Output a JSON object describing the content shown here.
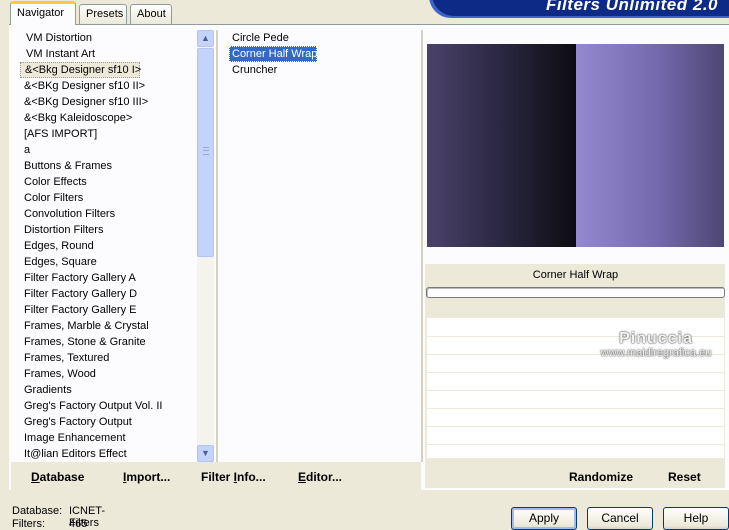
{
  "tabs": [
    {
      "label": "Navigator",
      "active": true
    },
    {
      "label": "Presets",
      "active": false
    },
    {
      "label": "About",
      "active": false
    }
  ],
  "banner_title": "Filters Unlimited 2.0",
  "categories": [
    "VM Distortion",
    "VM Instant Art",
    "&<Bkg Designer sf10 I>",
    "&<BKg Designer sf10 II>",
    "&<BKg Designer sf10 III>",
    "&<Bkg Kaleidoscope>",
    "[AFS IMPORT]",
    "a",
    "Buttons & Frames",
    "Color Effects",
    "Color Filters",
    "Convolution Filters",
    "Distortion Filters",
    "Edges, Round",
    "Edges, Square",
    "Filter Factory Gallery A",
    "Filter Factory Gallery D",
    "Filter Factory Gallery E",
    "Frames, Marble & Crystal",
    "Frames, Stone & Granite",
    "Frames, Textured",
    "Frames, Wood",
    "Gradients",
    "Greg's Factory Output Vol. II",
    "Greg's Factory Output",
    "Image Enhancement",
    "It@lian Editors Effect"
  ],
  "selected_category": "&<Bkg Designer sf10 I>",
  "filters": [
    "Circle Pede",
    "Corner Half Wrap",
    "Cruncher"
  ],
  "selected_filter": "Corner Half Wrap",
  "preview": {
    "filter_name": "Corner Half Wrap"
  },
  "watermark": {
    "name": "Pinuccia",
    "url": "www.maidiregrafica.eu"
  },
  "left_buttons": {
    "database": {
      "label": "Database",
      "mnemonic": "D",
      "rest": "atabase"
    },
    "import": {
      "label": "Import...",
      "mnemonic": "I",
      "rest": "mport..."
    },
    "filter_info": {
      "label": "Filter Info...",
      "pre": "Filter ",
      "mnemonic": "I",
      "rest": "nfo..."
    },
    "editor": {
      "label": "Editor...",
      "mnemonic": "E",
      "rest": "ditor..."
    }
  },
  "right_buttons": {
    "randomize": "Randomize",
    "reset": "Reset"
  },
  "status": {
    "database_label": "Database:",
    "database_value": "ICNET-Filters",
    "filters_label": "Filters:",
    "filters_value": "465"
  },
  "dialog_buttons": {
    "apply": "Apply",
    "cancel": "Cancel",
    "help": "Help"
  },
  "colors": {
    "selection": "#316ac5",
    "banner": "#0c2a86",
    "tab_highlight": "#ffc83c"
  }
}
